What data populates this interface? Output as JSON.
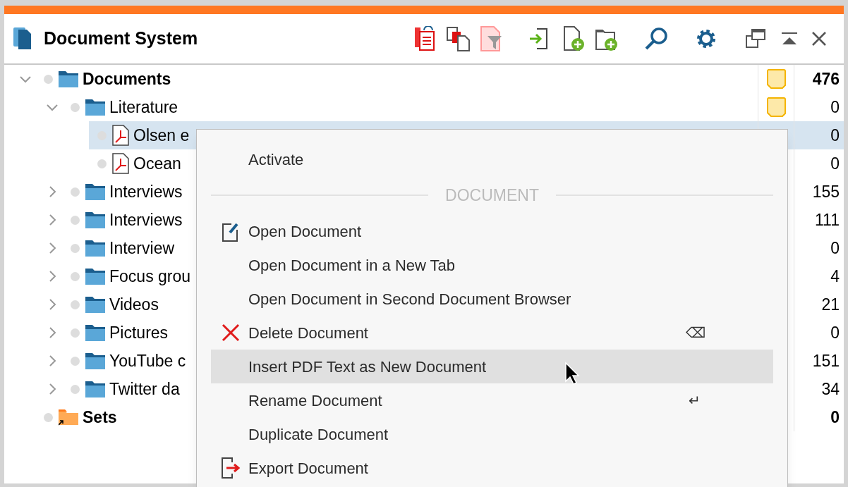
{
  "window": {
    "title": "Document System"
  },
  "tree": [
    {
      "label": "Documents",
      "kind": "folder",
      "expanded": true,
      "count": "476",
      "memo": true,
      "selected": false,
      "children": [
        {
          "label": "Literature",
          "kind": "folder",
          "expanded": true,
          "count": "0",
          "memo": true,
          "selected": false,
          "children": [
            {
              "label": "Olsen e",
              "kind": "pdf",
              "count": "0",
              "selected": true
            },
            {
              "label": "Ocean",
              "kind": "pdf",
              "count": "0",
              "selected": false
            }
          ]
        },
        {
          "label": "Interviews",
          "kind": "folder",
          "expanded": false,
          "count": "155",
          "selected": false
        },
        {
          "label": "Interviews",
          "kind": "folder",
          "expanded": false,
          "count": "111",
          "selected": false
        },
        {
          "label": "Interview",
          "kind": "folder",
          "expanded": false,
          "count": "0",
          "selected": false
        },
        {
          "label": "Focus grou",
          "kind": "folder",
          "expanded": false,
          "count": "4",
          "selected": false
        },
        {
          "label": "Videos",
          "kind": "folder",
          "expanded": false,
          "count": "21",
          "selected": false
        },
        {
          "label": "Pictures",
          "kind": "folder",
          "expanded": false,
          "count": "0",
          "selected": false
        },
        {
          "label": "YouTube c",
          "kind": "folder",
          "expanded": false,
          "count": "151",
          "selected": false
        },
        {
          "label": "Twitter da",
          "kind": "folder",
          "expanded": false,
          "count": "34",
          "selected": false
        }
      ]
    },
    {
      "label": "Sets",
      "kind": "set",
      "count": "0",
      "selected": false
    }
  ],
  "context_menu": [
    {
      "kind": "item",
      "label": "Activate",
      "selected": false
    },
    {
      "kind": "header",
      "label": "DOCUMENT"
    },
    {
      "kind": "item",
      "label": "Open Document",
      "selected": false
    },
    {
      "kind": "item",
      "label": "Open Document in a New Tab",
      "selected": false
    },
    {
      "kind": "item",
      "label": "Open Document in Second Document Browser",
      "selected": false
    },
    {
      "kind": "item",
      "label": "Delete Document",
      "shortcut": "⌫",
      "selected": false
    },
    {
      "kind": "item",
      "label": "Insert PDF Text as New Document",
      "selected": true
    },
    {
      "kind": "item",
      "label": "Rename Document",
      "shortcut": "↵",
      "selected": false
    },
    {
      "kind": "item",
      "label": "Duplicate Document",
      "selected": false
    },
    {
      "kind": "item",
      "label": "Export Document",
      "selected": false
    }
  ]
}
